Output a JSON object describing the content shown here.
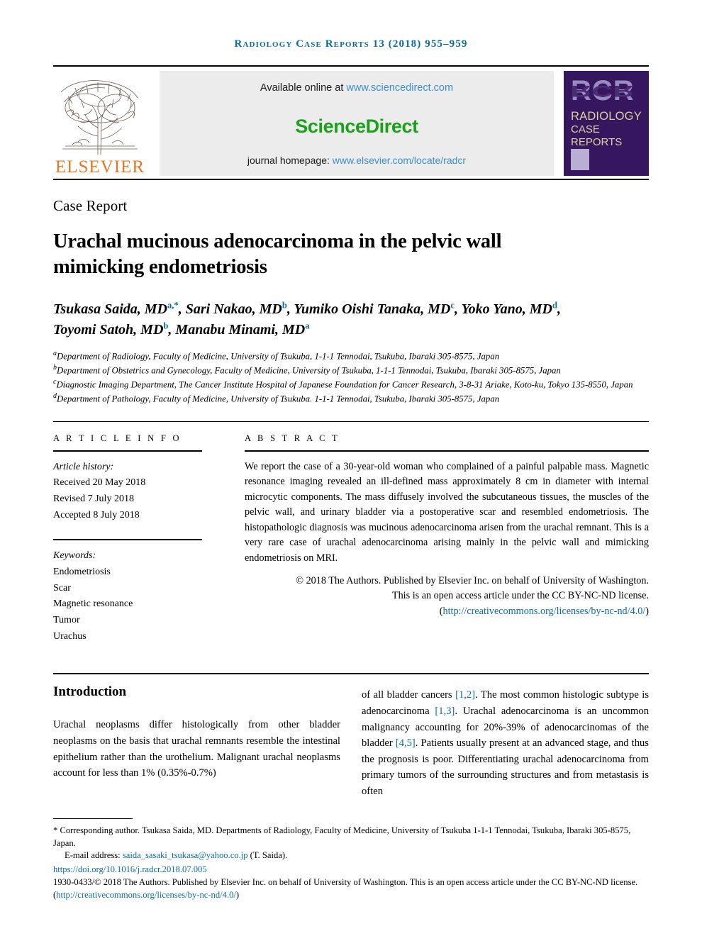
{
  "running_head": "Radiology Case Reports 13 (2018) 955–959",
  "masthead": {
    "elsevier_wordmark": "ELSEVIER",
    "elsevier_tree_icon": "tree-logo-icon",
    "available_online_prefix": "Available online at ",
    "sciencedirect_url": "www.sciencedirect.com",
    "sciencedirect_logo": "ScienceDirect",
    "journal_homepage_prefix": "journal homepage: ",
    "journal_homepage_url": "www.elsevier.com/locate/radcr",
    "cover": {
      "acronym": "RCR",
      "line1": "RADIOLOGY",
      "line2": "CASE",
      "line3": "REPORTS",
      "background_color": "#36165e",
      "acronym_color": "#9b8bc4",
      "text_color": "#ddd1a0"
    },
    "colors": {
      "band_background": "#ececec",
      "link_blue": "#3d8ec9",
      "sciencedirect_green": "#1aa11a",
      "elsevier_orange": "#e87722"
    }
  },
  "article": {
    "doc_type": "Case Report",
    "title": "Urachal mucinous adenocarcinoma in the pelvic wall mimicking endometriosis",
    "authors_line1_parts": [
      {
        "name": "Tsukasa Saida, MD",
        "sup": "a,*"
      },
      {
        "name": "Sari Nakao, MD",
        "sup": "b"
      },
      {
        "name": "Yumiko Oishi Tanaka, MD",
        "sup": "c"
      },
      {
        "name": "Yoko Yano, MD",
        "sup": "d"
      }
    ],
    "authors_line2_parts": [
      {
        "name": "Toyomi Satoh, MD",
        "sup": "b"
      },
      {
        "name": "Manabu Minami, MD",
        "sup": "a"
      }
    ],
    "affiliations": [
      {
        "marker": "a",
        "text": "Department of Radiology, Faculty of Medicine, University of Tsukuba, 1-1-1 Tennodai, Tsukuba, Ibaraki 305-8575, Japan"
      },
      {
        "marker": "b",
        "text": "Department of Obstetrics and Gynecology, Faculty of Medicine, University of Tsukuba, 1-1-1 Tennodai, Tsukuba, Ibaraki 305-8575, Japan"
      },
      {
        "marker": "c",
        "text": "Diagnostic Imaging Department, The Cancer Institute Hospital of Japanese Foundation for Cancer Research, 3-8-31 Ariake, Koto-ku, Tokyo 135-8550, Japan"
      },
      {
        "marker": "d",
        "text": "Department of Pathology, Faculty of Medicine, University of Tsukuba. 1-1-1 Tennodai, Tsukuba, Ibaraki 305-8575, Japan"
      }
    ]
  },
  "article_info": {
    "heading": "A R T I C L E    I N F O",
    "history_label": "Article history:",
    "received": "Received 20 May 2018",
    "revised": "Revised 7 July 2018",
    "accepted": "Accepted 8 July 2018",
    "keywords_label": "Keywords:",
    "keywords": [
      "Endometriosis",
      "Scar",
      "Magnetic resonance",
      "Tumor",
      "Urachus"
    ]
  },
  "abstract": {
    "heading": "A B S T R A C T",
    "text": "We report the case of a 30-year-old woman who complained of a painful palpable mass. Magnetic resonance imaging revealed an ill-defined mass approximately 8 cm in diameter with internal microcytic components. The mass diffusely involved the subcutaneous tissues, the muscles of the pelvic wall, and urinary bladder via a postoperative scar and resembled endometriosis. The histopathologic diagnosis was mucinous adenocarcinoma arisen from the urachal remnant. This is a very rare case of urachal adenocarcinoma arising mainly in the pelvic wall and mimicking endometriosis on MRI.",
    "copyright_line1": "© 2018 The Authors. Published by Elsevier Inc. on behalf of University of Washington.",
    "copyright_line2": "This is an open access article under the CC BY-NC-ND license.",
    "license_url": "http://creativecommons.org/licenses/by-nc-nd/4.0/"
  },
  "introduction": {
    "heading": "Introduction",
    "left_text": "Urachal neoplasms differ histologically from other bladder neoplasms on the basis that urachal remnants resemble the intestinal epithelium rather than the urothelium. Malignant urachal neoplasms account for less than 1% (0.35%-0.7%)",
    "right_segments": [
      {
        "t": "of all bladder cancers ",
        "ref": false
      },
      {
        "t": "[1,2]",
        "ref": true
      },
      {
        "t": ". The most common histologic subtype is adenocarcinoma ",
        "ref": false
      },
      {
        "t": "[1,3]",
        "ref": true
      },
      {
        "t": ". Urachal adenocarcinoma is an uncommon malignancy accounting for 20%-39% of adenocarcinomas of the bladder ",
        "ref": false
      },
      {
        "t": "[4,5]",
        "ref": true
      },
      {
        "t": ". Patients usually present at an advanced stage, and thus the prognosis is poor. Differentiating urachal adenocarcinoma from primary tumors of the surrounding structures and from metastasis is often",
        "ref": false
      }
    ]
  },
  "footnotes": {
    "corresponding": "* Corresponding author. Tsukasa Saida, MD. Departments of Radiology, Faculty of Medicine, University of Tsukuba 1-1-1 Tennodai, Tsukuba, Ibaraki 305-8575, Japan.",
    "email_label": "E-mail address: ",
    "email": "saida_sasaki_tsukasa@yahoo.co.jp",
    "email_suffix": " (T. Saida).",
    "doi": "https://doi.org/10.1016/j.radcr.2018.07.005",
    "issn_text": "1930-0433/© 2018 The Authors. Published by Elsevier Inc. on behalf of University of Washington. This is an open access article under the CC BY-NC-ND license. (",
    "issn_license_url": "http://creativecommons.org/licenses/by-nc-nd/4.0/",
    "issn_close": ")"
  }
}
